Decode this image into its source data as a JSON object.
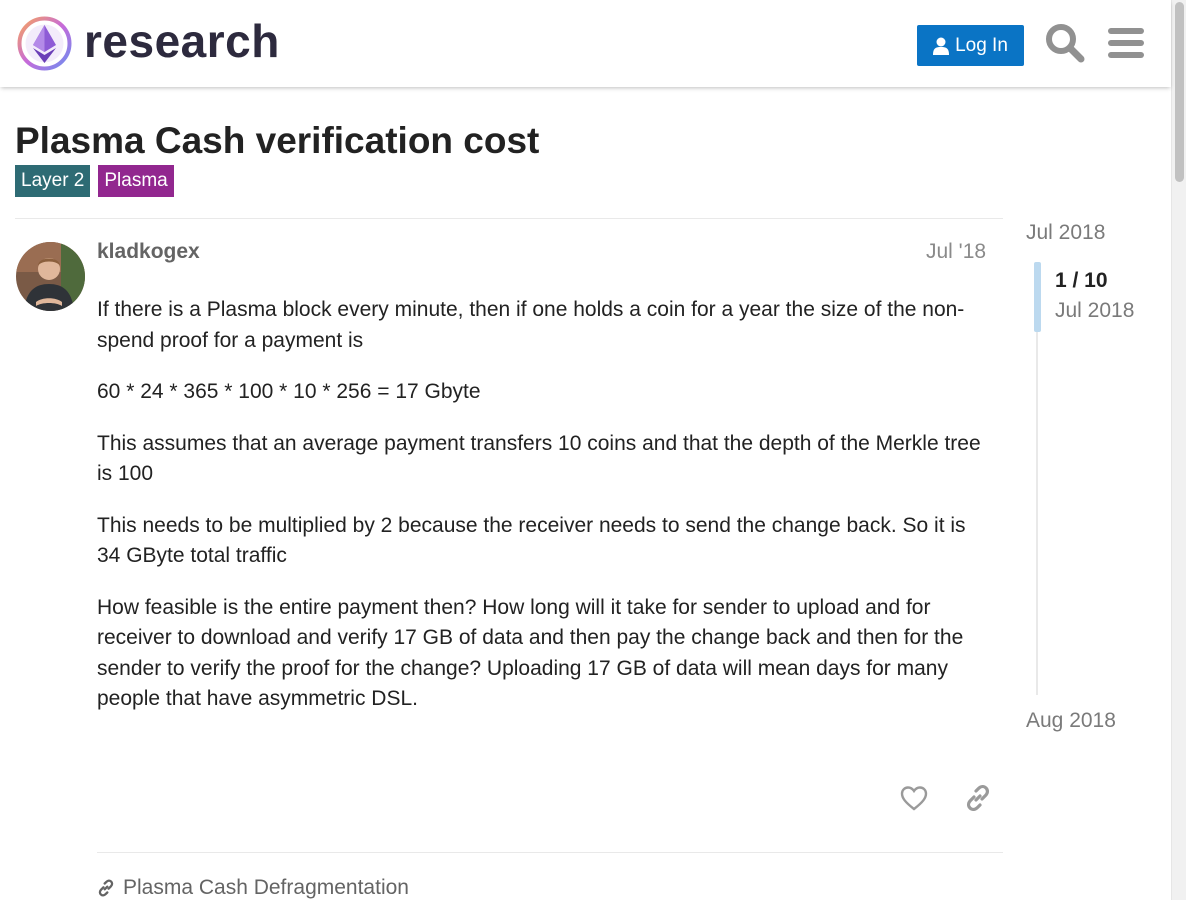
{
  "header": {
    "site_name": "research",
    "login_label": "Log In",
    "search_icon": "search-icon",
    "menu_icon": "hamburger-menu-icon"
  },
  "topic": {
    "title": "Plasma Cash verification cost",
    "tags": [
      {
        "label": "Layer 2",
        "color": "#2e6b74"
      },
      {
        "label": "Plasma",
        "color": "#92278f"
      }
    ]
  },
  "post": {
    "username": "kladkogex",
    "date": "Jul '18",
    "paragraphs": [
      "If there is a Plasma block every minute, then if one holds a coin for a year the size of the non-spend proof for a payment is",
      "60 * 24 * 365 * 100 * 10 * 256 = 17 Gbyte",
      "This assumes that an average payment transfers 10 coins and that the depth of the Merkle tree is 100",
      "This needs to be multiplied by 2 because the receiver needs to send the change back. So it is 34 GByte total traffic",
      "How feasible is the entire payment then? How long will it take for sender to upload and for receiver to download and verify 17 GB of data and then pay the change back and then for the sender to verify the proof for the change? Uploading 17 GB of data will mean days for many people that have asymmetric DSL."
    ],
    "linked_topic": "Plasma Cash Defragmentation"
  },
  "timeline": {
    "start_label": "Jul 2018",
    "position": "1 / 10",
    "current_date": "Jul 2018",
    "end_label": "Aug 2018"
  },
  "colors": {
    "accent": "#0a74c5",
    "tag_layer2": "#2e6b74",
    "tag_plasma": "#92278f"
  }
}
